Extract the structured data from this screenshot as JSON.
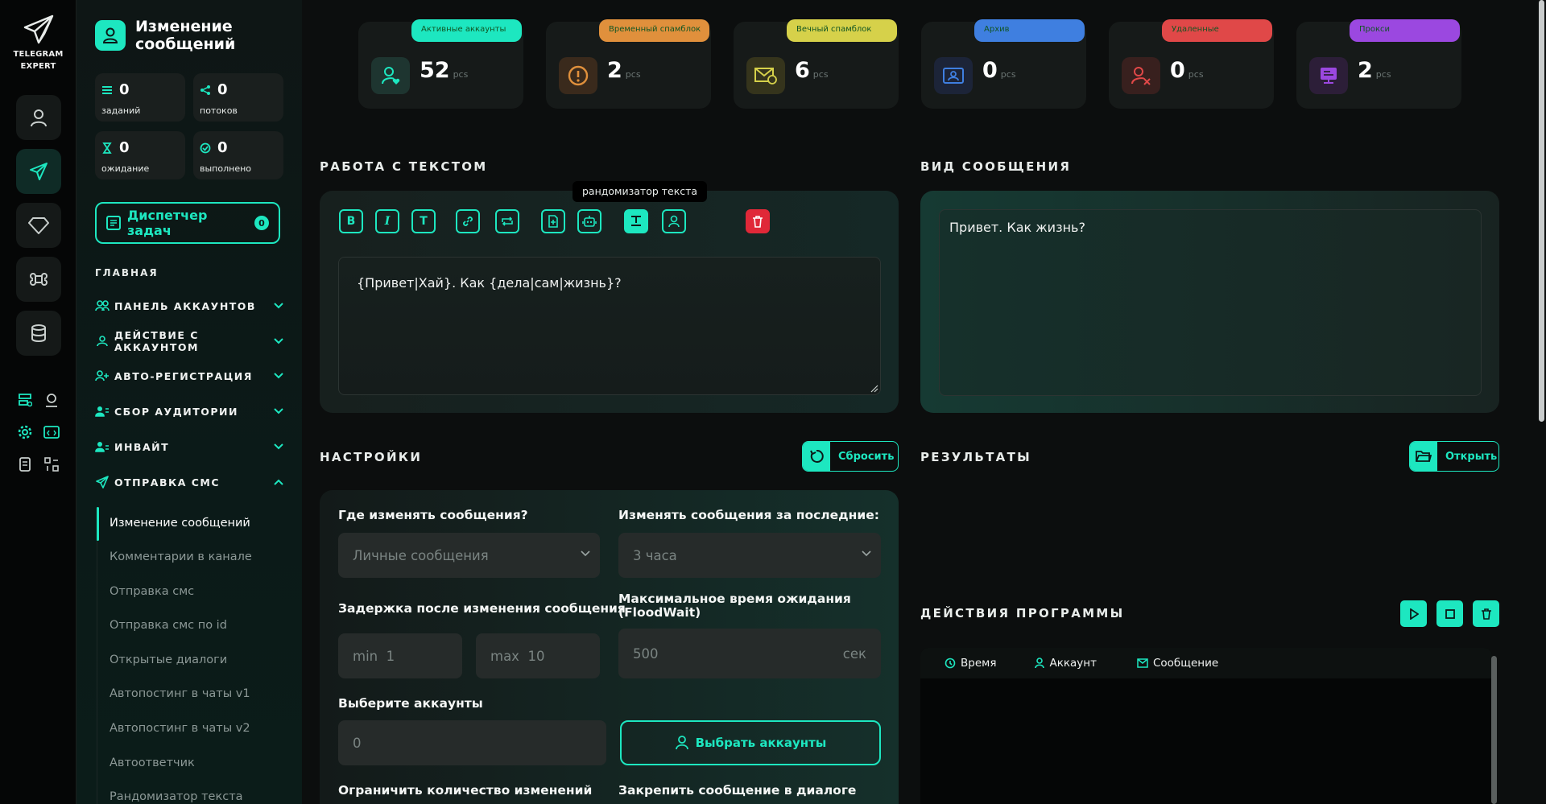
{
  "app": {
    "name_line1": "TELEGRAM",
    "name_line2": "EXPERT"
  },
  "rail": {
    "main_icons": [
      "user-icon",
      "send-icon",
      "diamond-icon",
      "command-icon",
      "database-icon"
    ],
    "small_icons": [
      "server-settings-icon",
      "location-user-icon",
      "gear-icon",
      "code-window-icon",
      "document-list-icon",
      "grid-arrows-icon"
    ]
  },
  "sidebar": {
    "title": "Изменение сообщений",
    "stats": [
      {
        "value": "0",
        "label": "заданий",
        "icon": "list-icon"
      },
      {
        "value": "0",
        "label": "потоков",
        "icon": "share-icon"
      },
      {
        "value": "0",
        "label": "ожидание",
        "icon": "hourglass-icon"
      },
      {
        "value": "0",
        "label": "выполнено",
        "icon": "check-circle-icon"
      }
    ],
    "task_manager": {
      "label": "Диспетчер задач",
      "count": "0"
    },
    "section": "ГЛАВНАЯ",
    "menu": [
      {
        "label": "ПАНЕЛЬ АККАУНТОВ"
      },
      {
        "label": "ДЕЙСТВИЕ С АККАУНТОМ"
      },
      {
        "label": "АВТО-РЕГИСТРАЦИЯ"
      },
      {
        "label": "СБОР АУДИТОРИИ"
      },
      {
        "label": "ИНВАЙТ"
      },
      {
        "label": "ОТПРАВКА СМС"
      }
    ],
    "submenu": [
      "Изменение сообщений",
      "Комментарии в канале",
      "Отправка смс",
      "Отправка смс по id",
      "Открытые диалоги",
      "Автопостинг в чаты v1",
      "Автопостинг в чаты v2",
      "Автоответчик",
      "Рандомизатор текста"
    ]
  },
  "cards": [
    {
      "label": "Активные аккаунты",
      "value": "52",
      "unit": "pcs",
      "color": "#1de7c0"
    },
    {
      "label": "Временный спамблок",
      "value": "2",
      "unit": "pcs",
      "color": "#e0903c"
    },
    {
      "label": "Вечный спамблок",
      "value": "6",
      "unit": "pcs",
      "color": "#d6d14a"
    },
    {
      "label": "Архив",
      "value": "0",
      "unit": "pcs",
      "color": "#3f7fe0"
    },
    {
      "label": "Удаленные",
      "value": "0",
      "unit": "pcs",
      "color": "#e04848"
    },
    {
      "label": "Прокси",
      "value": "2",
      "unit": "pcs",
      "color": "#9b48e0"
    }
  ],
  "text_work": {
    "heading": "РАБОТА С ТЕКСТОМ",
    "tooltip": "рандомизатор текста",
    "toolbar": {
      "bold": "B",
      "italic": "I",
      "text": "T"
    },
    "content": "{Привет|Хай}. Как {дела|сам|жизнь}?"
  },
  "preview": {
    "heading": "ВИД СООБЩЕНИЯ",
    "content": "Привет. Как жизнь?"
  },
  "settings": {
    "heading": "НАСТРОЙКИ",
    "reset": "Сбросить",
    "where_label": "Где изменять сообщения?",
    "where_value": "Личные сообщения",
    "period_label": "Изменять сообщения за последние:",
    "period_value": "3 часа",
    "delay_label": "Задержка после изменения сообщения",
    "min_label": "min",
    "min_value": "1",
    "max_label": "max",
    "max_value": "10",
    "floodwait_label": "Максимальное время ожидания (FloodWait)",
    "floodwait_value": "500",
    "floodwait_unit": "сек",
    "accounts_label": "Выберите аккаунты",
    "accounts_value": "0",
    "pick_accounts": "Выбрать аккаунты",
    "limit_label": "Ограничить количество изменений",
    "pin_label": "Закрепить сообщение в диалоге"
  },
  "results": {
    "heading": "РЕЗУЛЬТАТЫ",
    "open": "Открыть"
  },
  "actions": {
    "heading": "ДЕЙСТВИЯ ПРОГРАММЫ",
    "columns": [
      "Время",
      "Аккаунт",
      "Сообщение"
    ]
  }
}
